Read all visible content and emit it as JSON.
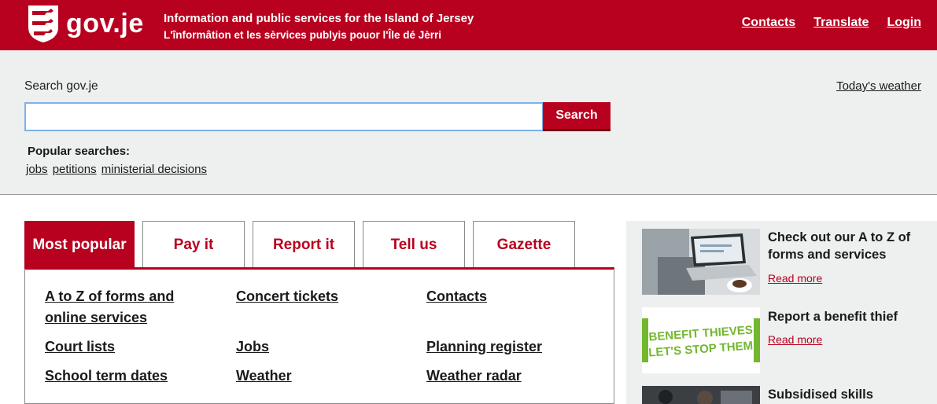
{
  "header": {
    "logo_text": "gov.je",
    "tagline_en": "Information and public services for the Island of Jersey",
    "tagline_jer": "L'înformâtion et les sèrvices publyis pouor l'Île dé Jèrri",
    "nav": [
      "Contacts",
      "Translate",
      "Login"
    ]
  },
  "search": {
    "label": "Search gov.je",
    "value": "",
    "placeholder": "",
    "button": "Search",
    "popular_label": "Popular searches:",
    "popular": [
      "jobs",
      "petitions",
      "ministerial decisions"
    ],
    "weather": "Today's weather"
  },
  "tabs": [
    {
      "label": "Most popular",
      "active": true
    },
    {
      "label": "Pay it",
      "active": false
    },
    {
      "label": "Report it",
      "active": false
    },
    {
      "label": "Tell us",
      "active": false
    },
    {
      "label": "Gazette",
      "active": false
    }
  ],
  "panel": {
    "links": [
      "A to Z of forms and online services",
      "Concert tickets",
      "Contacts",
      "Court lists",
      "Jobs",
      "Planning register",
      "School term dates",
      "Weather",
      "Weather radar"
    ]
  },
  "promos": [
    {
      "title": "Check out our A to Z of forms and services",
      "more": "Read more"
    },
    {
      "title": "Report a benefit thief",
      "more": "Read more",
      "image_text": [
        "BENEFIT THIEVES",
        "LET'S STOP THEM"
      ]
    },
    {
      "title": "Subsidised skills"
    }
  ],
  "colors": {
    "brand": "#b8001f",
    "band": "#eeefef",
    "input_focus": "#7fb1e8"
  }
}
